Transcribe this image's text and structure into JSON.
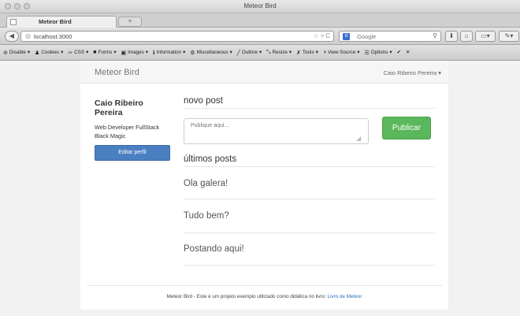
{
  "window": {
    "title": "Meteor Bird",
    "tab_title": "Meteor Bird",
    "new_tab_label": "+"
  },
  "navbar": {
    "url": "localhost:3000",
    "search_placeholder": "Google"
  },
  "devbar": {
    "items": [
      "Disable",
      "Cookies",
      "CSS",
      "Forms",
      "Images",
      "Information",
      "Miscellaneous",
      "Outline",
      "Resize",
      "Tools",
      "View Source",
      "Options"
    ]
  },
  "site": {
    "brand": "Meteor Bird",
    "user_menu": "Caio Ribeiro Pereira"
  },
  "profile": {
    "name": "Caio Ribeiro Pereira",
    "bio": "Web Developer FullStack Black Magic",
    "edit_button": "Editar perfil"
  },
  "compose": {
    "title": "novo post",
    "placeholder": "Publique aqui...",
    "publish_button": "Publicar"
  },
  "feed": {
    "title": "últimos posts",
    "posts": [
      "Ola galera!",
      "Tudo bem?",
      "Postando aqui!"
    ]
  },
  "footer": {
    "text": "Meteor Bird - Este é um projeto exemplo utilizado como didática no livro: ",
    "link": "Livro de Meteor"
  },
  "colors": {
    "primary_button": "#4a7fc1",
    "success_button": "#5bb75b",
    "link": "#2a6ebb"
  }
}
